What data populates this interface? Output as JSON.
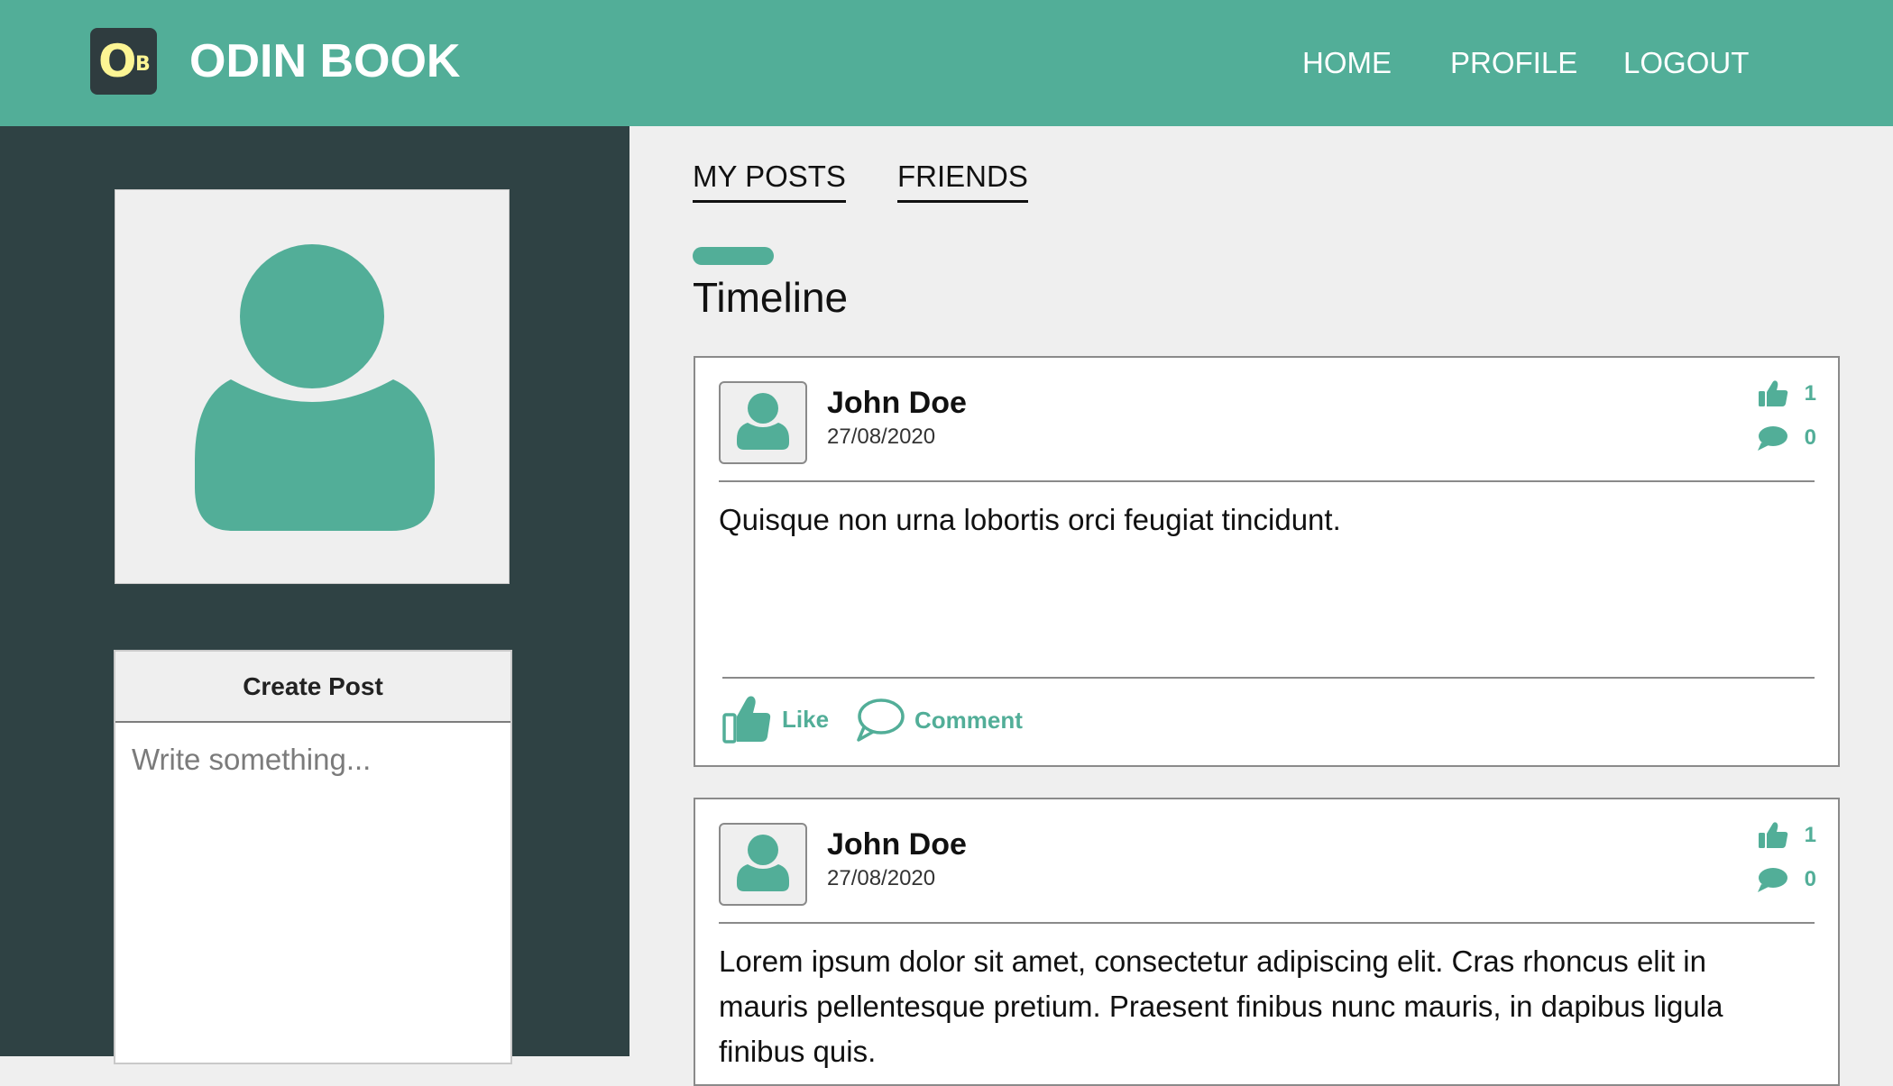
{
  "header": {
    "logo_letter_main": "O",
    "logo_letter_sub": "B",
    "brand": "ODIN BOOK",
    "nav": [
      "HOME",
      "PROFILE",
      "LOGOUT"
    ]
  },
  "sidebar": {
    "create_post_title": "Create Post",
    "create_post_placeholder": "Write something..."
  },
  "main": {
    "tabs": [
      "MY POSTS",
      "FRIENDS"
    ],
    "section_title": "Timeline",
    "posts": [
      {
        "author": "John Doe",
        "date": "27/08/2020",
        "likes": "1",
        "comments": "0",
        "text": "Quisque non urna lobortis orci feugiat tincidunt.",
        "like_label": "Like",
        "comment_label": "Comment"
      },
      {
        "author": "John Doe",
        "date": "27/08/2020",
        "likes": "1",
        "comments": "0",
        "text": "Lorem ipsum dolor sit amet, consectetur adipiscing elit. Cras rhoncus elit in mauris pellentesque pretium. Praesent finibus nunc mauris, in dapibus ligula finibus quis."
      }
    ]
  },
  "colors": {
    "accent": "#52ae98",
    "sidebar_bg": "#2f4244",
    "logo_bg": "#2f3c3f",
    "logo_letters": "#fcf594"
  },
  "icons": {
    "logo": "ob-logo-icon",
    "avatar": "user-silhouette-icon",
    "like": "thumbs-up-icon",
    "comment": "speech-bubble-icon"
  }
}
